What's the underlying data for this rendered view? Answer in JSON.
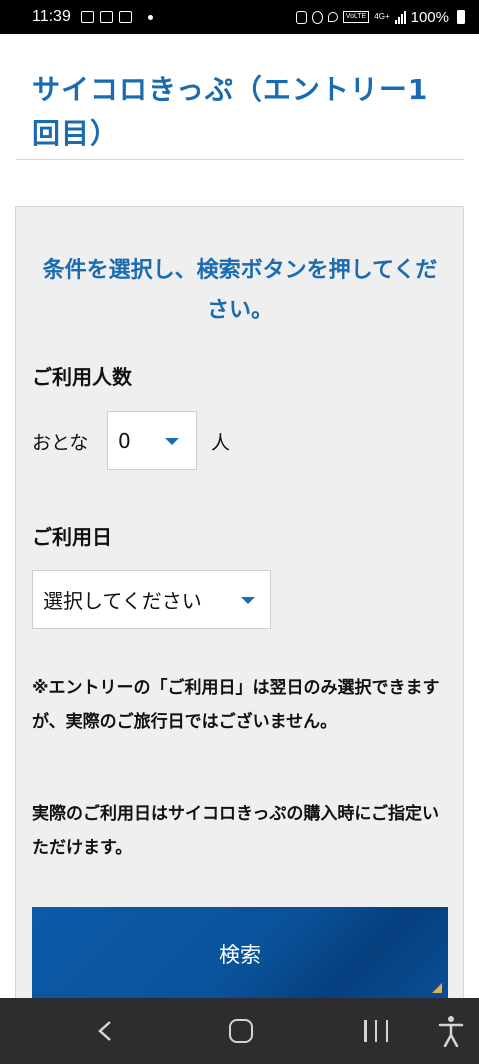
{
  "status_bar": {
    "time": "11:39",
    "battery": "100%",
    "network": "4G+",
    "volte": "VoLTE"
  },
  "page": {
    "title": "サイコロきっぷ（エントリー1回目）"
  },
  "form": {
    "instruction": "条件を選択し、検索ボタンを押してください。",
    "users_section": {
      "label": "ご利用人数",
      "adult_label": "おとな",
      "adult_count": "0",
      "unit": "人"
    },
    "date_section": {
      "label": "ご利用日",
      "selected": "選択してください"
    },
    "notes": [
      "※エントリーの「ご利用日」は翌日のみ選択できますが、実際のご旅行日ではございません。",
      "実際のご利用日はサイコロきっぷの購入時にご指定いただけます。"
    ],
    "search_label": "検索"
  },
  "colors": {
    "accent": "#1a6bb0",
    "button": "#0a5199",
    "panel_bg": "#efefef",
    "corner_mark": "#e2b04a"
  },
  "nav_icons": [
    "back-icon",
    "home-icon",
    "recent-apps-icon",
    "accessibility-icon"
  ]
}
